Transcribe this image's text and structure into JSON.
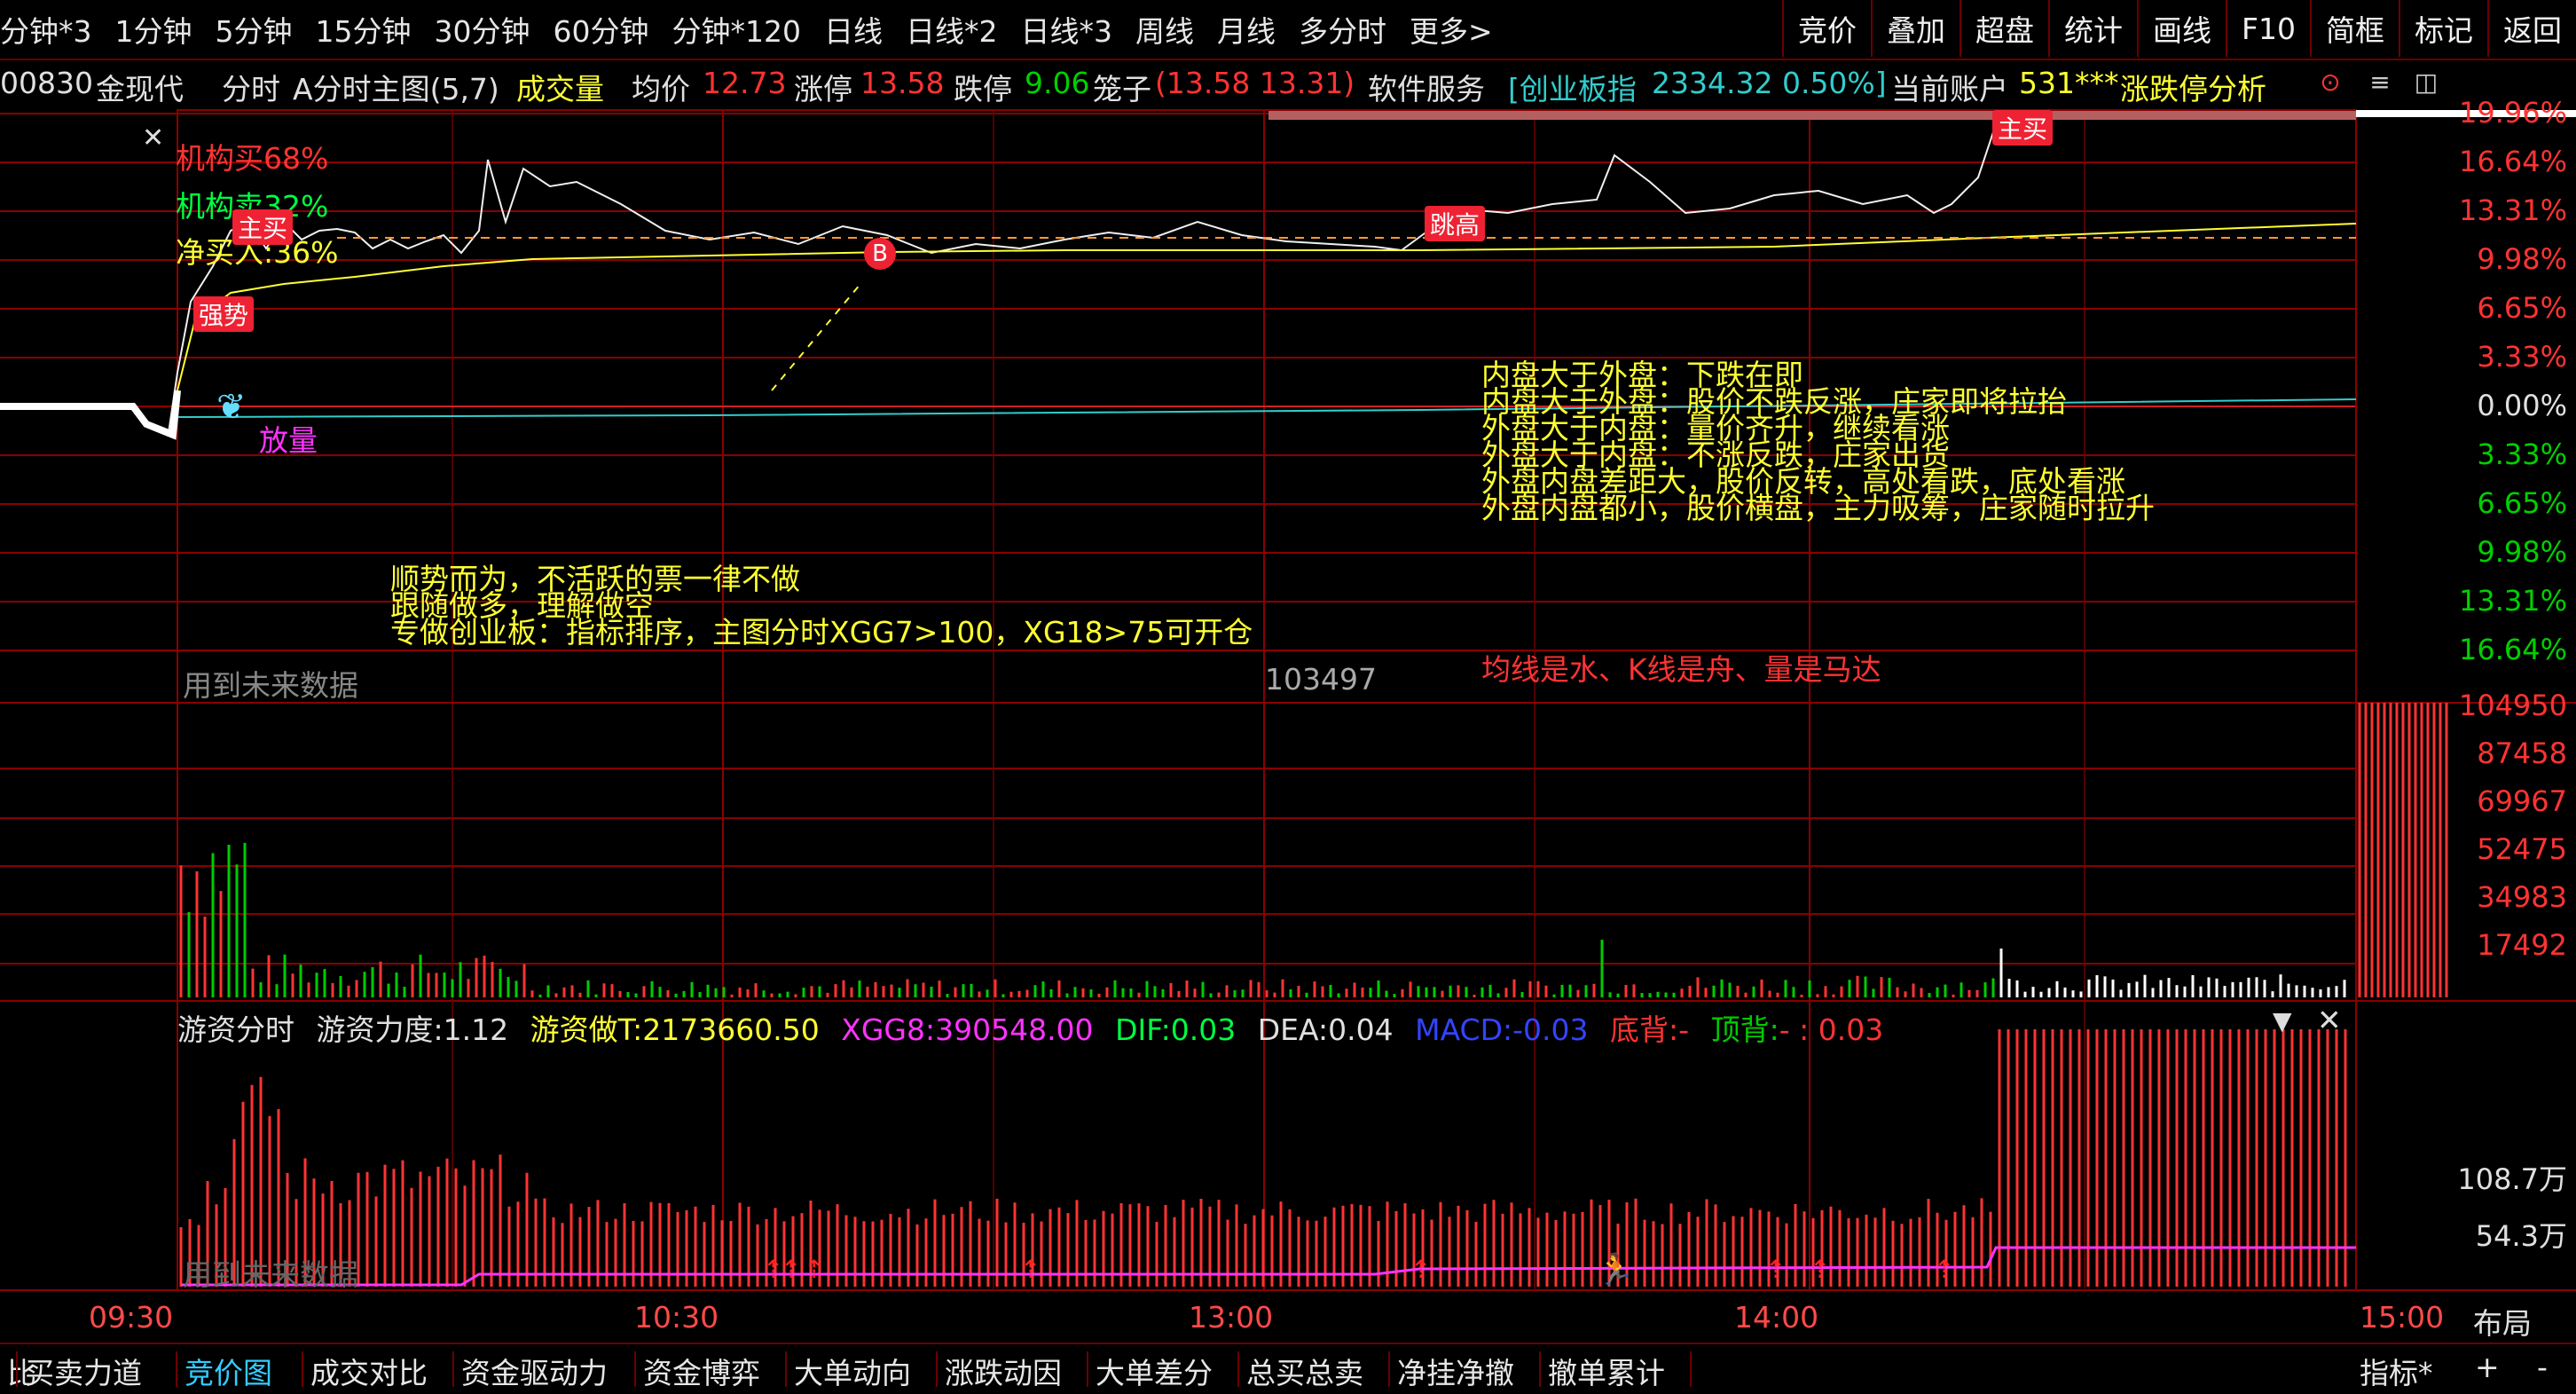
{
  "toolbar": {
    "periods": [
      "分钟*3",
      "1分钟",
      "5分钟",
      "15分钟",
      "30分钟",
      "60分钟",
      "分钟*120",
      "日线",
      "日线*2",
      "日线*3",
      "周线",
      "月线",
      "多分时",
      "更多>"
    ],
    "tools": [
      "竞价",
      "叠加",
      "超盘",
      "统计",
      "画线",
      "F10",
      "简框",
      "标记",
      "返回"
    ]
  },
  "info": {
    "code": "00830",
    "name": "金现代",
    "chart_type": "分时",
    "main_chart": "A分时主图(5,7)",
    "volume_label": "成交量",
    "avg_label": "均价",
    "avg_value": "12.73",
    "limit_up_label": "涨停",
    "limit_up_value": "13.58",
    "limit_down_label": "跌停",
    "limit_down_value": "9.06",
    "cage_label": "笼子",
    "cage_value": "(13.58 13.31)",
    "sector": "软件服务",
    "index_name": "[创业板指",
    "index_value": "2334.32 0.50%]",
    "account_label": "当前账户",
    "account_value": "531***",
    "overlay_text": "涨跌停分析"
  },
  "price_axis": [
    "19.96%",
    "16.64%",
    "13.31%",
    "9.98%",
    "6.65%",
    "3.33%",
    "0.00%",
    "3.33%",
    "6.65%",
    "9.98%",
    "13.31%",
    "16.64%"
  ],
  "volume_axis": [
    "104950",
    "87458",
    "69967",
    "52475",
    "34983",
    "17492"
  ],
  "indicator_axis": [
    "108.7万",
    "54.3万"
  ],
  "time_axis": [
    "09:30",
    "10:30",
    "13:00",
    "14:00",
    "15:00"
  ],
  "layout_label": "布局",
  "annotations": {
    "inst_buy": "机构买68%",
    "inst_sell": "机构卖32%",
    "net_buy": "净买入:36%",
    "main_buy_tag": "主买",
    "strong_tag": "强势",
    "release_volume": "放量",
    "buy_marker": "B",
    "jump_tag": "跳高",
    "main_buy_tag2": "主买",
    "panel_notes": [
      "内盘大于外盘：下跌在即",
      "内盘大于外盘：股价不跌反涨，庄家即将拉抬",
      "外盘大于内盘：量价齐升，继续看涨",
      "外盘大于内盘：不涨反跌，庄家出货",
      "外盘内盘差距大，股价反转，高处看跌，底处看涨",
      "外盘内盘都小，股价横盘，主力吸筹，庄家随时拉升"
    ],
    "strategy_notes": [
      "顺势而为，不活跃的票一律不做",
      "跟随做多，理解做空",
      "专做创业板：指标排序，主图分时XGG7>100，XG18>75可开仓"
    ],
    "future_data": "用到未来数据",
    "volume_value": "103497",
    "motto": "均线是水、K线是舟、量是马达",
    "future_data2": "用到未来数据"
  },
  "indicator": {
    "name": "游资分时",
    "force_label": "游资力度:",
    "force_value": "1.12",
    "t_label": "游资做T:",
    "t_value": "2173660.50",
    "xgg8_label": "XGG8:",
    "xgg8_value": "390548.00",
    "dif_label": "DIF:",
    "dif_value": "0.03",
    "dea_label": "DEA:",
    "dea_value": "0.04",
    "macd_label": "MACD:",
    "macd_value": "-0.03",
    "bottom_div": "底背:",
    "bottom_div_value": "-",
    "top_div": "顶背:",
    "top_div_value": "- : 0.03"
  },
  "bottom_tabs": [
    "比",
    "买卖力道",
    "竞价图",
    "成交对比",
    "资金驱动力",
    "资金博弈",
    "大单动向",
    "涨跌动因",
    "大单差分",
    "总买总卖",
    "净挂净撤",
    "撤单累计"
  ],
  "bottom_right": [
    "指标*",
    "+",
    "-"
  ],
  "colors": {
    "up": "#ff3333",
    "down": "#00d000",
    "grid": "#8a0000",
    "yellow": "#ffff33",
    "cyan": "#33cccc",
    "magenta": "#ff33ff"
  }
}
